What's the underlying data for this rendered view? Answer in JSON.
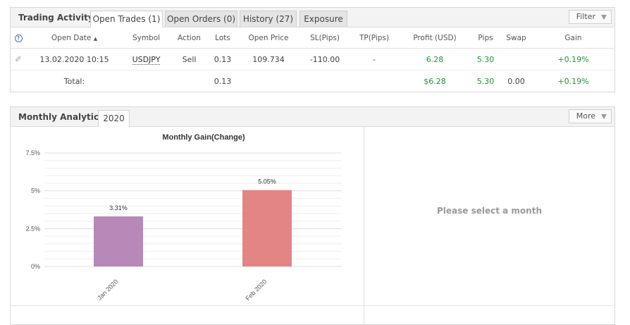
{
  "trading": {
    "title": "Trading Activity",
    "tabs": [
      {
        "label": "Open Trades (1)"
      },
      {
        "label": "Open Orders (0)"
      },
      {
        "label": "History (27)"
      },
      {
        "label": "Exposure"
      }
    ],
    "filter_label": "Filter",
    "columns": [
      "Open Date",
      "Symbol",
      "Action",
      "Lots",
      "Open Price",
      "SL(Pips)",
      "TP(Pips)",
      "Profit (USD)",
      "Pips",
      "Swap",
      "Gain"
    ],
    "row": {
      "open_date": "13.02.2020 10:15",
      "symbol": "USDJPY",
      "action": "Sell",
      "lots": "0.13",
      "open_price": "109.734",
      "sl": "-110.00",
      "tp": "-",
      "profit": "6.28",
      "pips": "5.30",
      "swap": "",
      "gain": "+0.19%"
    },
    "total": {
      "label": "Total:",
      "lots": "0.13",
      "profit": "$6.28",
      "pips": "5.30",
      "swap": "0.00",
      "gain": "+0.19%"
    }
  },
  "analytics": {
    "title": "Monthly Analytics",
    "tab_label": "2020",
    "more_label": "More",
    "empty_message": "Please select a month"
  },
  "colors": {
    "positive": "#1a9a2a",
    "bar_jan": "#b888b8",
    "bar_feb": "#e38585"
  },
  "chart_data": {
    "type": "bar",
    "title": "Monthly Gain(Change)",
    "categories": [
      "Jan 2020",
      "Feb 2020"
    ],
    "values": [
      3.31,
      5.05
    ],
    "value_labels": [
      "3.31%",
      "5.05%"
    ],
    "ylim": [
      0,
      7.5
    ],
    "yticks": [
      0,
      2.5,
      5,
      7.5
    ],
    "ytick_labels": [
      "0%",
      "2.5%",
      "5%",
      "7.5%"
    ],
    "grid": true
  }
}
